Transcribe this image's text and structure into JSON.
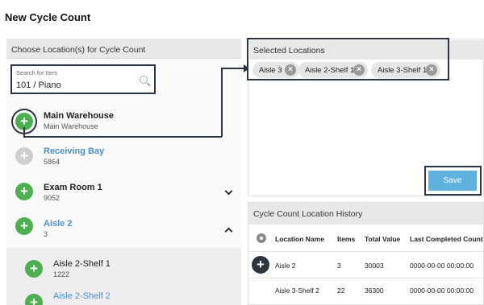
{
  "page": {
    "title": "New Cycle Count"
  },
  "left_panel": {
    "header": "Choose Location(s) for Cycle Count",
    "search": {
      "label": "Search for Item",
      "value": "101 / Piano"
    },
    "locations": [
      {
        "name": "Main Warehouse",
        "sub": "Main Warehouse",
        "state": "ringed"
      },
      {
        "name": "Receiving Bay",
        "sub": "5864",
        "state": "disabled"
      },
      {
        "name": "Exam Room 1",
        "sub": "9052",
        "state": "collapsed"
      },
      {
        "name": "Aisle 2",
        "sub": "3",
        "state": "expanded"
      }
    ],
    "sub_locations": [
      {
        "name": "Aisle 2-Shelf 1",
        "sub": "1222"
      },
      {
        "name": "Aisle 2-Shelf 2",
        "sub": ""
      }
    ]
  },
  "selected": {
    "header": "Selected Locations",
    "chips": [
      "Aisle 3",
      "Aisle 2-Shelf 1",
      "Aisle 3-Shelf 1"
    ],
    "save_label": "Save"
  },
  "history": {
    "header": "Cycle Count Location History",
    "columns": [
      "Location Name",
      "Items",
      "Total Value",
      "Last Completed Count"
    ],
    "rows": [
      [
        "Aisle 2",
        "3",
        "30003",
        "0000-00-00 00:00:00"
      ],
      [
        "Aisle 3-Shelf 2",
        "22",
        "36300",
        "0000-00-00 00:00:00"
      ]
    ]
  },
  "colors": {
    "accent_green": "#4caf50",
    "save_blue": "#5fb2e0",
    "highlight": "#2b3440",
    "link_blue": "#4a90c9"
  }
}
